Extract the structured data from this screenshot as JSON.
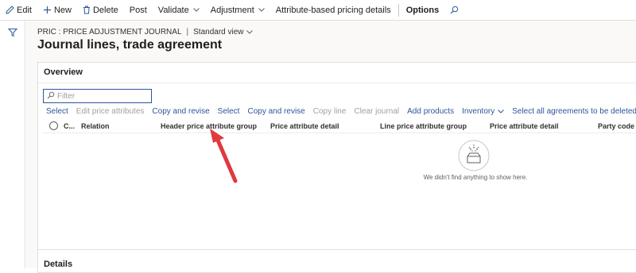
{
  "toolbar": {
    "edit": "Edit",
    "new": "New",
    "delete": "Delete",
    "post": "Post",
    "validate": "Validate",
    "adjustment": "Adjustment",
    "attribute_pricing": "Attribute-based pricing details",
    "options": "Options"
  },
  "breadcrumb": {
    "journal": "PRIC : PRICE ADJUSTMENT JOURNAL",
    "separator": "|",
    "view": "Standard view"
  },
  "page": {
    "title": "Journal lines, trade agreement"
  },
  "overview": {
    "title": "Overview",
    "filter_placeholder": "Filter",
    "actions": {
      "select1": "Select",
      "edit_price_attributes": "Edit price attributes",
      "copy_and_revise1": "Copy and revise",
      "select2": "Select",
      "copy_and_revise2": "Copy and revise",
      "copy_line": "Copy line",
      "clear_journal": "Clear journal",
      "add_products": "Add products",
      "inventory": "Inventory",
      "select_all": "Select all agreements to be deleted"
    },
    "columns": {
      "c": "C...",
      "relation": "Relation",
      "header_price_attr_group": "Header price attribute group",
      "price_attr_detail1": "Price attribute detail",
      "line_price_attr_group": "Line price attribute group",
      "price_attr_detail2": "Price attribute detail",
      "party_code_type": "Party code type"
    },
    "empty_message": "We didn't find anything to show here."
  },
  "details": {
    "title": "Details"
  },
  "colors": {
    "accent": "#2b579a",
    "arrow": "#e0393e"
  },
  "icons": [
    "edit-icon",
    "add-icon",
    "delete-icon",
    "search-icon",
    "filter-icon",
    "chevron-down-icon",
    "empty-state-icon"
  ]
}
